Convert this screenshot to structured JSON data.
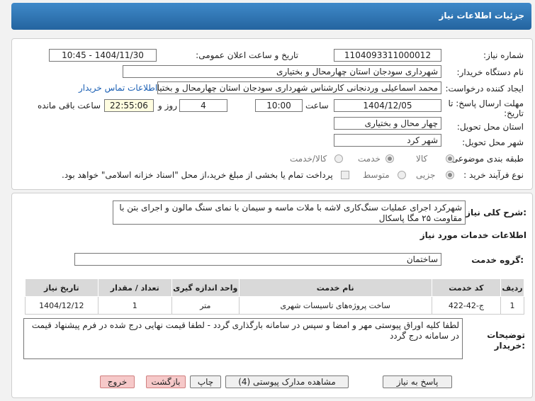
{
  "header": {
    "title": "جزئیات اطلاعات نیاز"
  },
  "form": {
    "need_number_label": "شماره نیاز:",
    "need_number": "1104093311000012",
    "announce_label": "تاریخ و ساعت اعلان عمومی:",
    "announce_value": "1404/11/30 - 10:45",
    "buyer_label": "نام دستگاه خریدار:",
    "buyer_value": "شهرداری سودجان استان چهارمحال و بختیاری",
    "creator_label": "ایجاد کننده درخواست:",
    "creator_value": "محمد اسماعیلی وردنجانی کارشناس شهرداری سودجان استان چهارمحال و بختیاری",
    "contact_link": "اطلاعات تماس خریدار",
    "deadline_label_1": "مهلت ارسال پاسخ: تا",
    "deadline_label_2": "تاریخ:",
    "deadline_date": "1404/12/05",
    "time_label": "ساعت",
    "deadline_time": "10:00",
    "days_value": "4",
    "day_and_label": "روز و",
    "remaining_value": "22:55:06",
    "remaining_label": "ساعت باقی مانده",
    "province_label": "استان محل تحویل:",
    "province_value": "چهار محال و بختیاری",
    "city_label": "شهر محل تحویل:",
    "city_value": "شهر کرد",
    "category_label": "طبقه بندی موضوعی:",
    "category_options": [
      "کالا",
      "خدمت",
      "کالا/خدمت"
    ],
    "process_label": "نوع فرآیند خرید :",
    "process_options": [
      "جزیی",
      "متوسط"
    ],
    "payment_text": "پرداخت تمام یا بخشی از مبلغ خرید،از محل \"اسناد خزانه اسلامی\" خواهد بود."
  },
  "details": {
    "summary_label": "شرح کلی نیاز:",
    "summary_text": "شهرکرد اجرای عملیات سنگ‌کاری لاشه با ملات ماسه و سیمان با نمای سنگ مالون و اجرای بتن با مقاومت ۲۵ مگا پاسکال",
    "services_title": "اطلاعات خدمات مورد نیاز",
    "service_group_label": "گروه خدمت:",
    "service_group_value": "ساختمان",
    "table": {
      "headers": [
        "ردیف",
        "کد خدمت",
        "نام خدمت",
        "واحد اندازه گیری",
        "تعداد / مقدار",
        "تاریخ نیاز"
      ],
      "rows": [
        [
          "1",
          "ج-42-422",
          "ساخت پروژه‌های تاسیسات شهری",
          "متر",
          "1",
          "1404/12/12"
        ]
      ]
    },
    "buyer_notes_label_1": "توضیحات",
    "buyer_notes_label_2": "خریدار:",
    "buyer_notes_text": "لطفا کلیه اوراق پیوستی مهر و امضا و سپس در سامانه بارگذاری گردد - لطفا قیمت نهایی درج شده در فرم پیشنهاد قیمت در سامانه درج گردد"
  },
  "buttons": {
    "reply": "پاسخ به نیاز",
    "attachments": "مشاهده مدارک پیوستی (4)",
    "print": "چاپ",
    "back": "بازگشت",
    "exit": "خروج"
  }
}
